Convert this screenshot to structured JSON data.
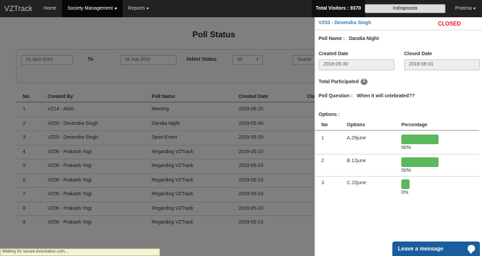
{
  "nav": {
    "brand": "VZTrack",
    "items": [
      {
        "label": "Home",
        "active": false
      },
      {
        "label": "Society Management",
        "active": true
      },
      {
        "label": "Reports",
        "active": false
      }
    ],
    "visitors": "Total Visitors : 9370",
    "society": "Indraprasta",
    "user": "Pratima"
  },
  "page": {
    "title": "Poll Status",
    "filters": {
      "from": "01 April 2019",
      "to_label": "To",
      "to": "18 July 2019",
      "status_label": "Select Status",
      "status_value": "All",
      "search_label": "Search"
    },
    "table": {
      "headers": [
        "No.",
        "Created By",
        "Poll Name",
        "Created Date",
        "Clo"
      ],
      "rows": [
        [
          "1",
          "VZ14 - Atish",
          "Meeting",
          "2019-06-25"
        ],
        [
          "2",
          "VZ03 - Devendra Singh",
          "Dandia Night",
          "2019-05-30"
        ],
        [
          "3",
          "VZ03 - Devendra Singh",
          "Sport Event",
          "2019-05-29"
        ],
        [
          "4",
          "VZ06 - Prakash Yogi",
          "Regarding VZTrack",
          "2019-05-23"
        ],
        [
          "5",
          "VZ06 - Prakash Yogi",
          "Regarding VZTrack",
          "2019-05-23"
        ],
        [
          "6",
          "VZ06 - Prakash Yogi",
          "Regarding VZTrack",
          "2019-05-23"
        ],
        [
          "7",
          "VZ06 - Prakash Yogi",
          "Regarding VZTrack",
          "2019-05-23"
        ],
        [
          "8",
          "VZ06 - Prakash Yogi",
          "Regarding VZTrack",
          "2019-05-23"
        ],
        [
          "9",
          "VZ06 - Prakash Yogi",
          "Regarding VZTrack",
          "2019-05-23"
        ]
      ]
    },
    "status_text": "Waiting for secure.livechatinc.com..."
  },
  "panel": {
    "creator": "VZ03 - Devendra Singh",
    "status": "CLOSED",
    "poll_name_label": "Poll Name :",
    "poll_name": "Dandia Night",
    "created_label": "Created Date",
    "created_value": "2019-05-30",
    "closed_label": "Closed Date",
    "closed_value": "2019-06-01",
    "participated_label": "Total Participated",
    "participated_count": "2",
    "question_label": "Poll Question :",
    "question": "When it will celebrated??",
    "options_label": "Options :",
    "options_headers": [
      "No",
      "Options",
      "Percentage"
    ],
    "options": [
      {
        "no": "1",
        "option": "A.29june",
        "percent": "50%",
        "fraction": 0.5
      },
      {
        "no": "2",
        "option": "B.12june",
        "percent": "50%",
        "fraction": 0.5
      },
      {
        "no": "3",
        "option": "C.15june",
        "percent": "0%",
        "fraction": 0
      }
    ]
  },
  "chat": {
    "label": "Leave a message",
    "icon": "chat-bubble-icon"
  },
  "colors": {
    "navbar": "#222222",
    "bar": "#5cb85c",
    "closed": "#e8112d",
    "link": "#337ab7",
    "chat": "#1a5d9e"
  }
}
